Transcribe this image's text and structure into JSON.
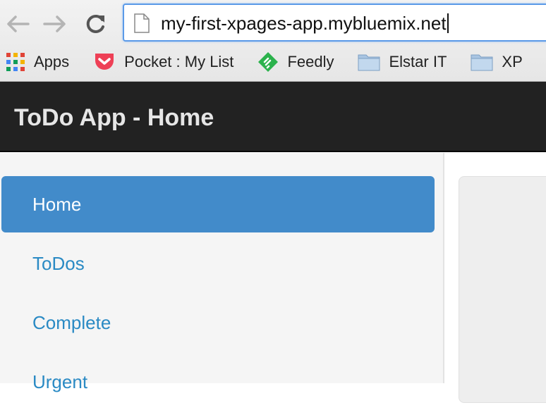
{
  "browser": {
    "url": "my-first-xpages-app.mybluemix.net",
    "bookmarks": [
      {
        "label": "Apps",
        "icon": "apps-grid-icon"
      },
      {
        "label": "Pocket : My List",
        "icon": "pocket-icon"
      },
      {
        "label": "Feedly",
        "icon": "feedly-icon"
      },
      {
        "label": "Elstar IT",
        "icon": "folder-icon"
      },
      {
        "label": "XP",
        "icon": "folder-icon"
      }
    ]
  },
  "app": {
    "title": "ToDo App - Home"
  },
  "sidebar": {
    "items": [
      {
        "label": "Home",
        "active": true
      },
      {
        "label": "ToDos",
        "active": false
      },
      {
        "label": "Complete",
        "active": false
      },
      {
        "label": "Urgent",
        "active": false
      }
    ]
  },
  "colors": {
    "accent": "#428bca",
    "link": "#2a8ac4",
    "navbar": "#222222",
    "sidebar_bg": "#f5f5f5"
  }
}
